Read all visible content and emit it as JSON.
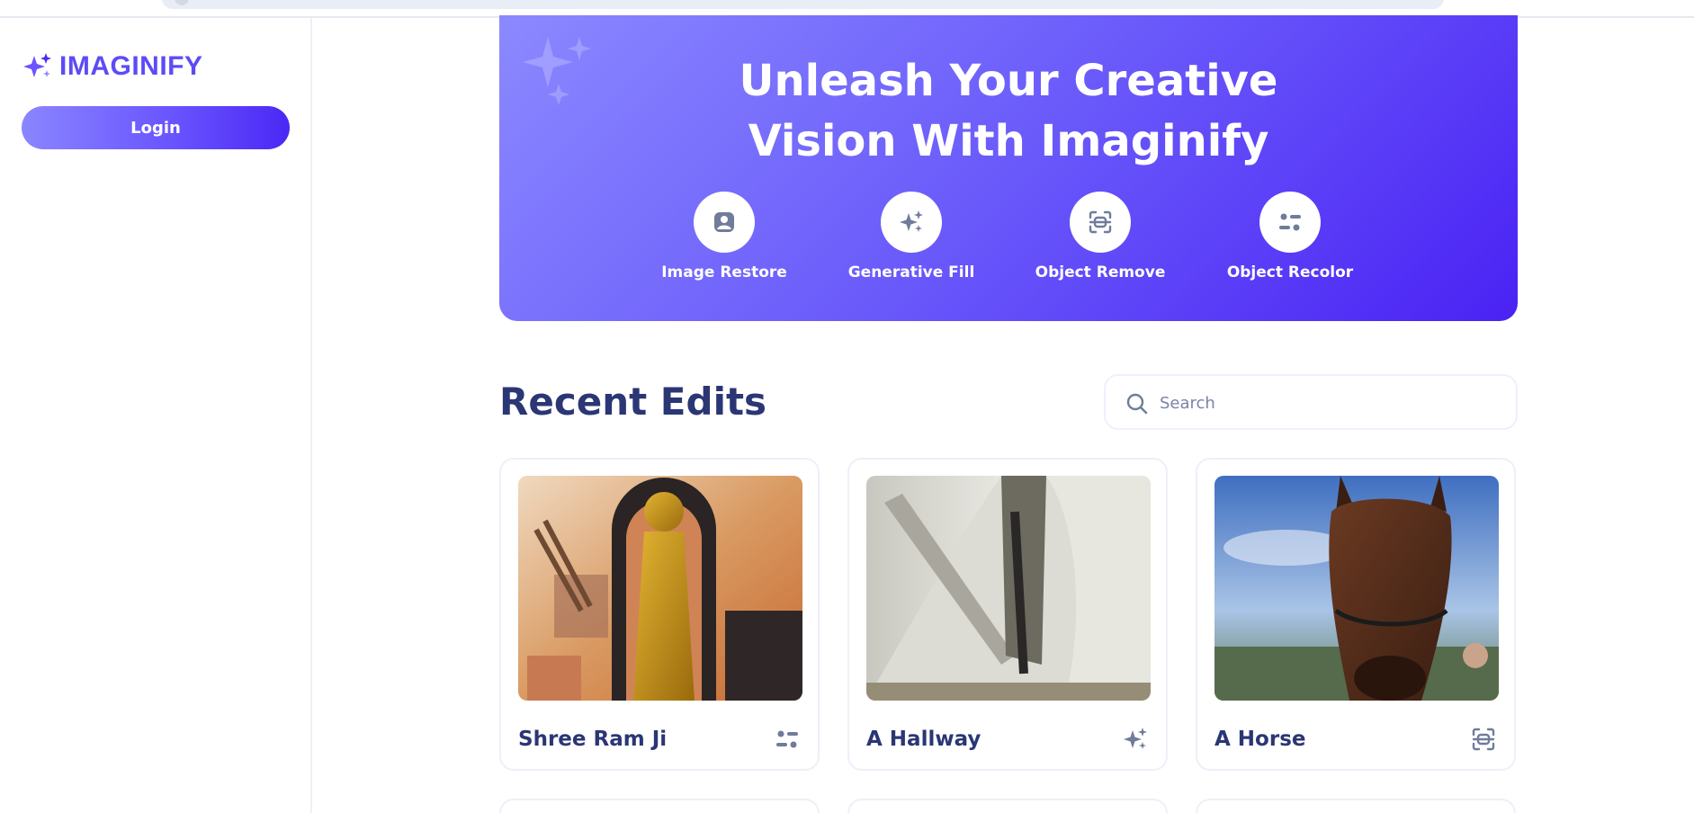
{
  "brand": {
    "name": "IMAGINIFY",
    "accent": "#5d4bf6",
    "icon": "sparkles-logo-icon"
  },
  "sidebar": {
    "login_label": "Login"
  },
  "hero": {
    "title_line1": "Unleash Your Creative",
    "title_line2": "Vision With Imaginify",
    "tools": [
      {
        "label": "Image Restore",
        "icon": "image-restore-icon"
      },
      {
        "label": "Generative Fill",
        "icon": "sparkles-icon"
      },
      {
        "label": "Object Remove",
        "icon": "scan-icon"
      },
      {
        "label": "Object Recolor",
        "icon": "filter-icon"
      }
    ]
  },
  "recent": {
    "title": "Recent Edits",
    "search": {
      "placeholder": "Search",
      "value": ""
    },
    "cards": [
      {
        "title": "Shree Ram Ji",
        "type_icon": "filter-icon"
      },
      {
        "title": "A Hallway",
        "type_icon": "sparkles-icon"
      },
      {
        "title": "A Horse",
        "type_icon": "scan-icon"
      }
    ]
  },
  "colors": {
    "hero_start": "#8b89ff",
    "hero_end": "#4a22f4",
    "text_dark": "#2b3674",
    "icon_gray": "#707c9c"
  }
}
